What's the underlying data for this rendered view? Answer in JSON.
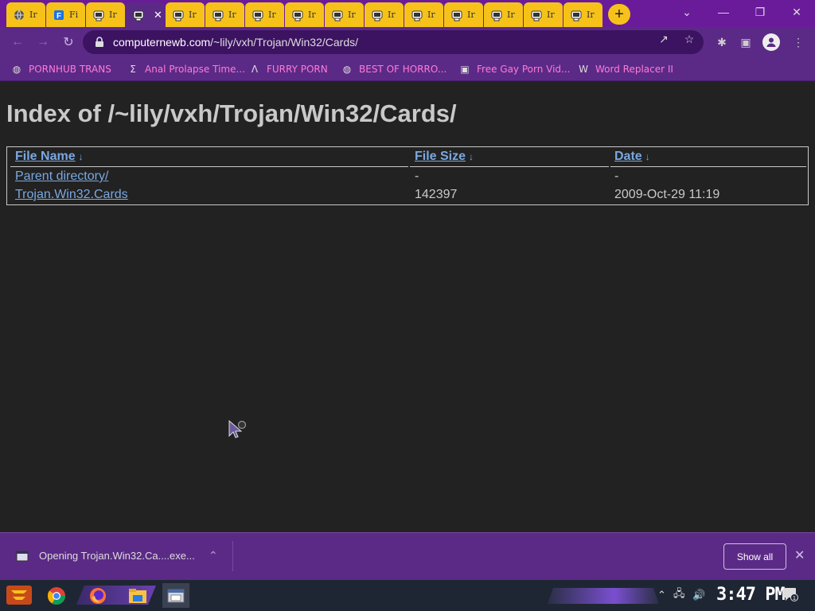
{
  "browser": {
    "tabs": [
      {
        "title": "Ir",
        "icon": "globe-icon"
      },
      {
        "title": "Fi",
        "icon": "f-logo-icon"
      },
      {
        "title": "Ir",
        "icon": "mascot-icon"
      },
      {
        "title": "",
        "icon": "mascot-icon",
        "active": true
      },
      {
        "title": "Ir",
        "icon": "mascot-icon"
      },
      {
        "title": "Ir",
        "icon": "mascot-icon"
      },
      {
        "title": "Ir",
        "icon": "mascot-icon"
      },
      {
        "title": "Ir",
        "icon": "mascot-icon"
      },
      {
        "title": "Ir",
        "icon": "mascot-icon"
      },
      {
        "title": "Ir",
        "icon": "mascot-icon"
      },
      {
        "title": "Ir",
        "icon": "mascot-icon"
      },
      {
        "title": "Ir",
        "icon": "mascot-icon"
      },
      {
        "title": "Ir",
        "icon": "mascot-icon"
      },
      {
        "title": "Ir",
        "icon": "mascot-icon"
      },
      {
        "title": "Ir",
        "icon": "mascot-icon"
      }
    ],
    "url_host": "computernewb.com",
    "url_path": "/~lily/vxh/Trojan/Win32/Cards/",
    "bookmarks": [
      {
        "label": "PORNHUB TRANS",
        "icon": "globe-icon"
      },
      {
        "label": "Anal Prolapse Time...",
        "icon": "sigma-icon"
      },
      {
        "label": "FURRY PORN",
        "icon": "lambda-icon"
      },
      {
        "label": "BEST OF HORRO...",
        "icon": "globe-icon"
      },
      {
        "label": "Free Gay Porn Vid...",
        "icon": "mascot-icon"
      },
      {
        "label": "Word Replacer II",
        "icon": "wr-icon"
      }
    ]
  },
  "page": {
    "title": "Index of /~lily/vxh/Trojan/Win32/Cards/",
    "headers": {
      "name": "File Name",
      "size": "File Size",
      "date": "Date",
      "sort": "↓"
    },
    "rows": [
      {
        "name": "Parent directory/",
        "size": "-",
        "date": "-"
      },
      {
        "name": "Trojan.Win32.Cards",
        "size": "142397",
        "date": "2009-Oct-29 11:19"
      }
    ]
  },
  "download_bar": {
    "filename": "Opening Trojan.Win32.Ca....exe...",
    "show_all": "Show all"
  },
  "taskbar": {
    "clock": "3:47 PM",
    "notification_count": "1"
  },
  "colors": {
    "tab_accent": "#f6c21a",
    "chrome_purple": "#5b2a86",
    "page_bg": "#222222",
    "link": "#7aa8e0",
    "bookmark_text": "#ff7ad9"
  }
}
